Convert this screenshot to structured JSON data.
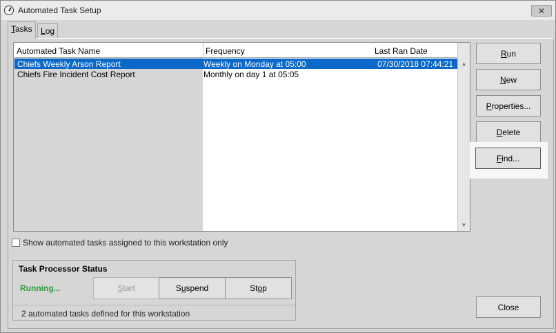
{
  "window": {
    "title": "Automated Task Setup",
    "close_glyph": "✕"
  },
  "tabs": [
    {
      "label": "Tasks",
      "mnemonic": "T",
      "rest": "asks"
    },
    {
      "label": "Log",
      "mnemonic": "L",
      "rest": "og"
    }
  ],
  "list": {
    "columns": [
      "Automated Task Name",
      "Frequency",
      "Last Ran Date"
    ],
    "rows": [
      {
        "name": "Chiefs Weekly Arson Report",
        "frequency": "Weekly on Monday at 05:00",
        "last_ran": "07/30/2018 07:44:21",
        "selected": true
      },
      {
        "name": "Chiefs Fire Incident Cost Report",
        "frequency": "Monthly on day 1 at 05:05",
        "last_ran": "",
        "selected": false
      }
    ]
  },
  "buttons": {
    "run": {
      "label": "Run",
      "mnemonic": "R",
      "rest": "un"
    },
    "new": {
      "label": "New",
      "mnemonic": "N",
      "rest": "ew"
    },
    "properties": {
      "label": "Properties...",
      "mnemonic": "P",
      "rest": "roperties..."
    },
    "delete": {
      "label": "Delete",
      "mnemonic": "D",
      "rest": "elete"
    },
    "find": {
      "label": "Find...",
      "mnemonic": "F",
      "rest": "ind..."
    },
    "close": {
      "label": "Close"
    }
  },
  "checkbox": {
    "label": "Show automated tasks assigned to this workstation only",
    "checked": false
  },
  "status": {
    "title": "Task Processor Status",
    "state": "Running...",
    "state_color": "#2e9a3c",
    "start": {
      "label": "Start",
      "mnemonic": "S",
      "rest": "tart",
      "enabled": false
    },
    "suspend": {
      "pre": "S",
      "mnemonic": "u",
      "rest": "spend",
      "label": "Suspend"
    },
    "stop": {
      "label": "Stop",
      "pre": "St",
      "mnemonic": "o",
      "rest": "p"
    },
    "count_text": "2 automated tasks defined for this workstation"
  },
  "colors": {
    "selection": "#0a68c8",
    "window_bg": "#d6d6d6"
  }
}
